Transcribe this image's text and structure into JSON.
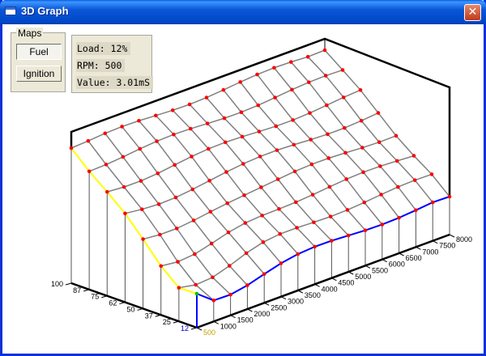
{
  "window": {
    "title": "3D Graph",
    "icon": "window-app-icon",
    "close_label": "✕"
  },
  "maps": {
    "group_label": "Maps",
    "buttons": [
      {
        "label": "Fuel",
        "pressed": true
      },
      {
        "label": "Ignition",
        "pressed": false
      }
    ]
  },
  "info": {
    "load": "Load: 12%",
    "rpm": "RPM: 500",
    "value": "Value: 3.01mS"
  },
  "axes": {
    "load_ticks": [
      "100",
      "87",
      "75",
      "62",
      "50",
      "37",
      "25",
      "12"
    ],
    "rpm_ticks": [
      "500",
      "1000",
      "1500",
      "2000",
      "2500",
      "3000",
      "3500",
      "4000",
      "4500",
      "5000",
      "5500",
      "6000",
      "6500",
      "7000",
      "7500",
      "8000"
    ]
  },
  "colors": {
    "mesh": "#808080",
    "point": "#ff0000",
    "load_edge": "#ffff00",
    "rpm_edge": "#0000ff",
    "selected": "#00c000"
  }
}
